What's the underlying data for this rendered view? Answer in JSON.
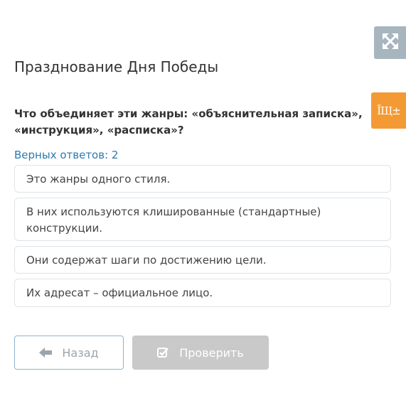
{
  "lesson": {
    "title": "Празднование Дня Победы"
  },
  "question": {
    "text": "Что объединяет эти жанры: «объяснительная записка», «инструкция», «расписка»?"
  },
  "correct_count_label": "Верных ответов: 2",
  "answers": [
    {
      "text": "Это жанры одного стиля."
    },
    {
      "text": "В них используются клишированные (стандартные) конструкции."
    },
    {
      "text": "Они содержат шаги по достижению цели."
    },
    {
      "text": "Их адресат – официальное лицо."
    }
  ],
  "side_buttons": {
    "expand_icon": "expand-arrows-icon",
    "language_icon": "language-switch-icon",
    "language_label": "ĪЩ±"
  },
  "navigation": {
    "back_label": "Назад",
    "back_icon": "arrow-left-icon",
    "check_label": "Проверить",
    "check_icon": "checkbox-check-icon"
  },
  "colors": {
    "accent_blue": "#2a7ab0",
    "expand_bg": "#a7b5bf",
    "language_bg": "#f49a35",
    "check_disabled_bg": "#c9c9c9"
  }
}
